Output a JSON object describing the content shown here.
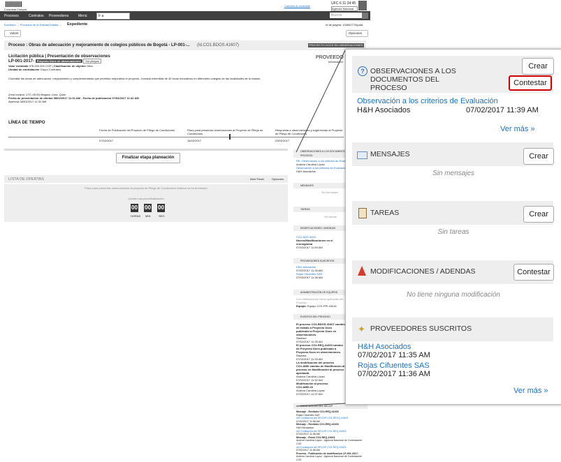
{
  "app": {
    "logo_text": "Colombia Compra Eficiente",
    "contact_link": "Cambiar al contraste",
    "user_code": "UFC-6",
    "user_time": "11:34:45",
    "agency": "Agencia Nacional"
  },
  "nav": {
    "items": [
      "Procesos",
      "Contratos",
      "Proveedores",
      "Menú"
    ],
    "select_value": "Ir a",
    "search_placeholder": "Buscar"
  },
  "breadcrumb": {
    "path": "Escritorio → Procesos de la Entidad Estatal →",
    "current": "Expediente",
    "page_id": "Id de página: 10006277",
    "help": "Ayuda"
  },
  "toolbar": {
    "back": "Volver",
    "options": "Opciones"
  },
  "process": {
    "title": "Proceso : Obras de adecuación y mejoramiento de colegios públicos de Bogotá  - LP-001-...",
    "id": "(Id.CO1.BDOS.41607)",
    "status": "PROYECTO DOCS EN OBSERVACIONES",
    "heading": "Licitación pública | Presentación de observaciones",
    "code": "LP-001-2017-",
    "badge1": "Proyecto Docs en observaciones",
    "badge2": "Sin pliegos",
    "value_label": "Valor estimado",
    "value": "978.000.000 COP",
    "class_label": "Clasificación de objetos",
    "class_value": "Obra",
    "unit_label": "Unidad de contratación",
    "unit_value": "Grupo Contratos",
    "description": "Contratar las obras de adecuación, mejoramiento y complementarias que permitan mejorarlas el proyecto. Jornada extendida de 40 locas educativos en diferentes colegios de las localidades de la ciudad.",
    "location": "Zona horaria: UTC-05:00) Bogotá, Lima, Quito",
    "pub_date": "Fecha de presentación de ofertas 08/02/2017 11:31 AM - Fecha de publicación 07/02/2017 11:32 AM",
    "opening": "Apertura 08/03/2017 11:32 AM",
    "right_label": "PROVEEDO",
    "right_sub": "Información"
  },
  "timeline": {
    "title": "LÍNEA DE TIEMPO",
    "events": [
      {
        "label": "Fecha de Publicación del Proyecto de Pliego de Condiciones",
        "date": "07/02/2017"
      },
      {
        "label": "Plazo para presentar observaciones al Proyecto de Pliego de Condiciones",
        "date": "16/02/2017"
      },
      {
        "label": "Respuesta a observaciones y sugerencias al Proyecto de Pliego de Condiciones",
        "date": "23/02/2017"
      }
    ]
  },
  "finalize_button": "Finalizar etapa planeación",
  "offers": {
    "title": "LISTA DE OFERTAS",
    "add_panel": "Abrir Panel",
    "options": "Opciones",
    "note": "Plazo para presentar observaciones al proyecto de Pliego de Condiciones todavía no ha terminado",
    "time_left_label": "Queda muy poco/finalización",
    "timer": [
      "00",
      "00",
      "00"
    ],
    "timer_units": [
      "HORAS",
      "MIN",
      "SEG"
    ]
  },
  "right_column": {
    "obs_title": "OBSERVACIONES A LOS DOCUMENTOS DEL PROCESO",
    "obs_item": "RE: Observación a los criterios de Evaluación",
    "obs_author": "Andrea Carolina López",
    "obs_item2": "Observación a los criterios de Evaluación",
    "obs_author2": "H&H Asociados",
    "msg_title": "MENSAJES",
    "msg_empty": "Sin mensajes",
    "tasks_title": "TAREAS",
    "tasks_empty": "Sin tareas",
    "mods_title": "MODIFICACIONES / ADENDAS",
    "mods_item": "CO1.ADD.3004",
    "mods_desc": "Nuevo/Modificaciones en el cronograma",
    "mods_date": "07/02/2017 11:59 AM",
    "prov_title": "PROVEEDORES SUSCRITOS",
    "prov1": "H&H Asociados",
    "prov1_date": "07/02/2017 11:35 AM",
    "prov2": "Rojas Cifuentes SAS",
    "prov2_date": "07/02/2017 11:36 AM",
    "team_title": "ADMINISTRACIÓN DE EQUIPOS",
    "team_note": "Los notificaciones serán aplicadas del Proceso",
    "team_label": "Equipo:",
    "team_value": "Equipo CO1.PPI.43416",
    "events_title": "EVENTOS DEL PROCESO",
    "event1": "El proceso CO1.BDOS.41607 cambio de estado a Proyecto Docs publicado a Proyecto Docs en observaciones.",
    "event1_author": "Sistema",
    "event1_date": "07/02/2017 11:35 AM",
    "event2": "El proceso CO1.REQ.41603 cambio de Proyecto Docs publicado a Proyecto Docs en observaciones.",
    "event2_author": "Sistema",
    "event2_date": "07/02/2017 11:33 AM",
    "event3": "La modificación del proceso CO1.AMD cambio de Modificación al proceso en Modificación al proceso aprobada.",
    "event3_author": "Andrea Carolina López",
    "event3_date": "07/02/2017 11:32 AM",
    "event4": "Modificación al proceso CO1.AMD.20",
    "event4_author": "Andrea Carolina López",
    "event4_date": "07/02/2017 11:37 AM",
    "secop_title": "CONSTANCIAS DEL SECOP",
    "secop_items": [
      "Mensaje - Recibido CO1.REQ.41603",
      "Rojas Cifuentes SAS",
      "ver Constancia del SECOP CO1.RECQ.41603",
      "07/02/2017 11:56 AM",
      "Mensaje - Recibido CO1.REQ.41603",
      "H&H Asociados",
      "ver Constancia del SECOP CO1.REQ.41603",
      "07/02/2017 11:56 AM",
      "Mensaje - Envío CO1.REQ.41603",
      "Andrea Carolina López - Agencia Nacional de Contratación CCE",
      "ver Constancia del SECOP CO1.REQ.41603",
      "07/02/2017 11:56 AM",
      "Proceso - Publicación de modificación LP-001-2017-",
      "Andrea Carolina López - Agencia Nacional de Contratación CCE"
    ]
  },
  "popup": {
    "obs": {
      "title": "OBSERVACIONES A LOS DOCUMENTOS DEL PROCESO",
      "create": "Crear",
      "reply": "Contestar",
      "item_link": "Observación a los criterios de Evaluación",
      "item_author": "H&H Asociados",
      "item_date": "07/02/2017 11:39 AM",
      "more": "Ver más »"
    },
    "messages": {
      "title": "MENSAJES",
      "create": "Crear",
      "empty": "Sin mensajes"
    },
    "tasks": {
      "title": "TAREAS",
      "create": "Crear",
      "empty": "Sin tareas"
    },
    "mods": {
      "title": "MODIFICACIONES / ADENDAS",
      "create": "Contestar",
      "empty": "No tiene ninguna modificación"
    },
    "providers": {
      "title": "PROVEEDORES SUSCRITOS",
      "items": [
        {
          "name": "H&H Asociados",
          "date": "07/02/2017 11:35 AM"
        },
        {
          "name": "Rojas Cifuentes SAS",
          "date": "07/02/2017 11:36 AM"
        }
      ],
      "more": "Ver más »"
    }
  },
  "colors": {
    "accent": "#d00000",
    "link": "#1a73c8",
    "nav": "#404040"
  }
}
